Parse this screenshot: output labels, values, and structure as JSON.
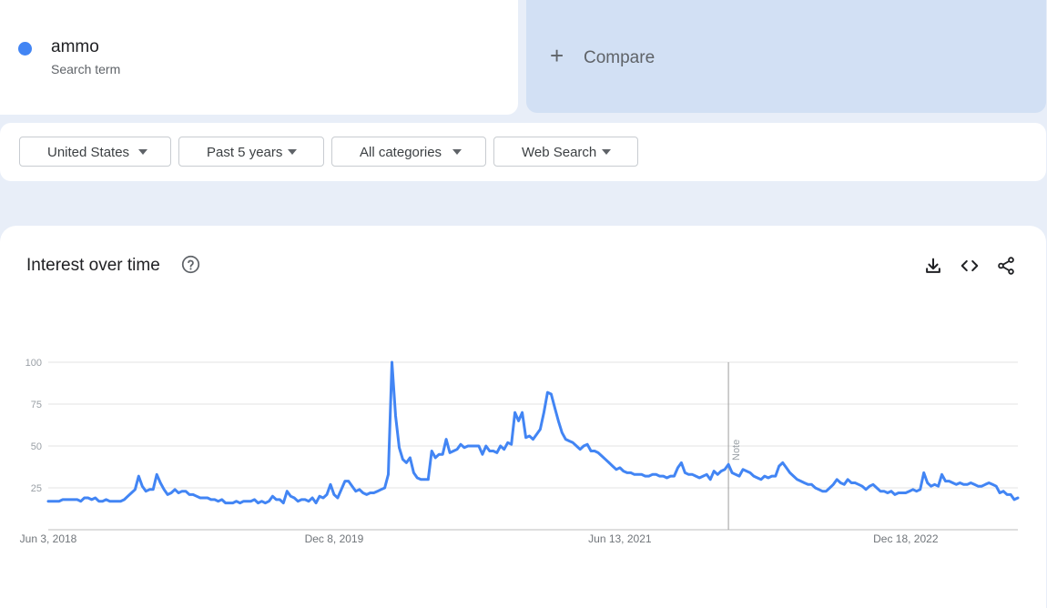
{
  "search_term": {
    "name": "ammo",
    "subtitle": "Search term",
    "color": "#4285f4"
  },
  "compare": {
    "label": "Compare"
  },
  "filters": {
    "region": "United States",
    "period": "Past 5 years",
    "category": "All categories",
    "search_type": "Web Search"
  },
  "panel": {
    "title": "Interest over time",
    "icons": [
      "help-icon",
      "download-icon",
      "embed-icon",
      "share-icon"
    ]
  },
  "chart_data": {
    "type": "line",
    "x_tick_labels": [
      "Jun 3, 2018",
      "Dec 8, 2019",
      "Jun 13, 2021",
      "Dec 18, 2022"
    ],
    "y_ticks": [
      25,
      50,
      75,
      100
    ],
    "ylim": [
      0,
      100
    ],
    "grid": true,
    "note_label": "Note",
    "note_at": "2022-01-09",
    "line_color": "#4285f4",
    "series": [
      {
        "start": "2018-06-03",
        "interval": "weekly",
        "values": [
          17,
          17,
          17,
          17,
          18,
          18,
          18,
          18,
          18,
          17,
          19,
          19,
          18,
          19,
          17,
          17,
          18,
          17,
          17,
          17,
          17,
          18,
          20,
          22,
          24,
          32,
          26,
          23,
          24,
          24,
          33,
          28,
          24,
          21,
          22,
          24,
          22,
          23,
          23,
          21,
          21,
          20,
          19,
          19,
          19,
          18,
          18,
          17,
          18,
          16,
          16,
          16,
          17,
          16,
          17,
          17,
          17,
          18,
          16,
          17,
          16,
          17,
          20,
          18,
          18,
          16,
          23,
          20,
          19,
          17,
          18,
          18,
          17,
          19,
          16,
          20,
          19,
          21,
          27,
          21,
          19,
          24,
          29,
          29,
          26,
          23,
          24,
          22,
          21,
          22,
          22,
          23,
          24,
          25,
          33,
          100,
          68,
          49,
          42,
          40,
          43,
          34,
          31,
          30,
          30,
          30,
          47,
          43,
          45,
          45,
          54,
          46,
          47,
          48,
          51,
          49,
          50,
          50,
          50,
          50,
          45,
          50,
          47,
          47,
          46,
          50,
          48,
          52,
          51,
          70,
          65,
          70,
          55,
          56,
          54,
          57,
          60,
          70,
          82,
          81,
          73,
          65,
          58,
          54,
          53,
          52,
          50,
          48,
          50,
          51,
          47,
          47,
          46,
          44,
          42,
          40,
          38,
          36,
          37,
          35,
          34,
          34,
          33,
          33,
          33,
          32,
          32,
          33,
          33,
          32,
          32,
          31,
          32,
          32,
          37,
          40,
          34,
          33,
          33,
          32,
          31,
          32,
          33,
          30,
          35,
          33,
          35,
          36,
          39,
          34,
          33,
          32,
          36,
          35,
          34,
          32,
          31,
          30,
          32,
          31,
          32,
          32,
          38,
          40,
          37,
          34,
          32,
          30,
          29,
          28,
          27,
          27,
          25,
          24,
          23,
          23,
          25,
          27,
          30,
          28,
          27,
          30,
          28,
          28,
          27,
          26,
          24,
          26,
          27,
          25,
          23,
          23,
          22,
          23,
          21,
          22,
          22,
          22,
          23,
          24,
          23,
          24,
          34,
          28,
          26,
          27,
          26,
          33,
          29,
          29,
          28,
          27,
          28,
          27,
          27,
          28,
          27,
          26,
          26,
          27,
          28,
          27,
          26,
          22,
          23,
          21,
          21,
          18,
          19
        ]
      }
    ]
  }
}
